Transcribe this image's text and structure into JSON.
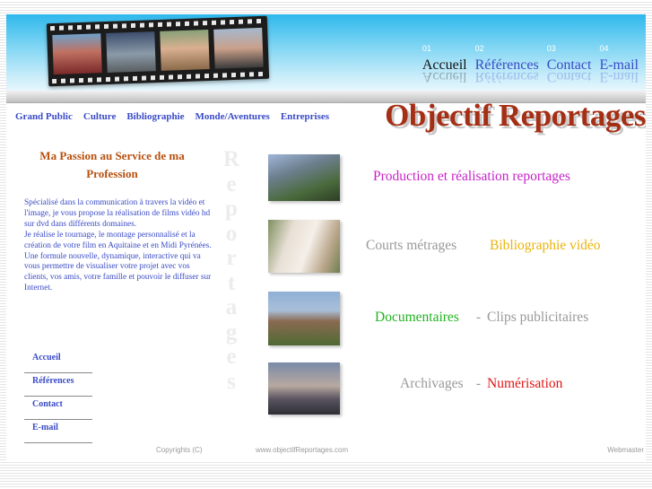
{
  "header": {
    "top_nav": [
      {
        "num": "01",
        "label": "Accueil",
        "active": true
      },
      {
        "num": "02",
        "label": "Références",
        "active": false
      },
      {
        "num": "03",
        "label": "Contact",
        "active": false
      },
      {
        "num": "04",
        "label": "E-mail",
        "active": false
      }
    ],
    "brand": "Objectif Reportages"
  },
  "categories": [
    "Grand Public",
    "Culture",
    "Bibliographie",
    "Monde/Aventures",
    "Entreprises"
  ],
  "vertical_word": [
    "R",
    "e",
    "p",
    "o",
    "r",
    "t",
    "a",
    "g",
    "e",
    "s"
  ],
  "sidebar": {
    "title": "Ma Passion au Service de ma Profession",
    "paragraphs": [
      "Spécialisé dans la communication à travers la vidéo et l'image, je vous propose la réalisation de films vidéo hd sur dvd dans différents domaines.",
      "Je réalise le tournage, le montage personnalisé et la création de votre film en Aquitaine et en Midi Pyrénées.",
      "Une formule nouvelle, dynamique, interactive qui va vous permettre de visualiser votre projet avec vos clients, vos amis, votre famille et pouvoir le diffuser sur Internet."
    ],
    "nav": [
      "Accueil",
      "Références",
      "Contact",
      "E-mail"
    ]
  },
  "services": {
    "s1": "Production et réalisation reportages",
    "s2a": "Courts métrages",
    "s2b": "Bibliographie vidéo",
    "s3a": "Documentaires",
    "sep": " - ",
    "s3b": "Clips publicitaires",
    "s4a": "Archivages",
    "s4b": "Numérisation"
  },
  "colors": {
    "brand": "#a52f14",
    "link": "#3a4bc6",
    "s1": "#c822c8",
    "bibliographie": "#e8b40a",
    "documentaires": "#22b322",
    "numerisation": "#e01414"
  },
  "footer": {
    "copyright": "Copyrights (C)",
    "url": "www.objectifReportages.com",
    "webmaster": "Webmaster"
  }
}
